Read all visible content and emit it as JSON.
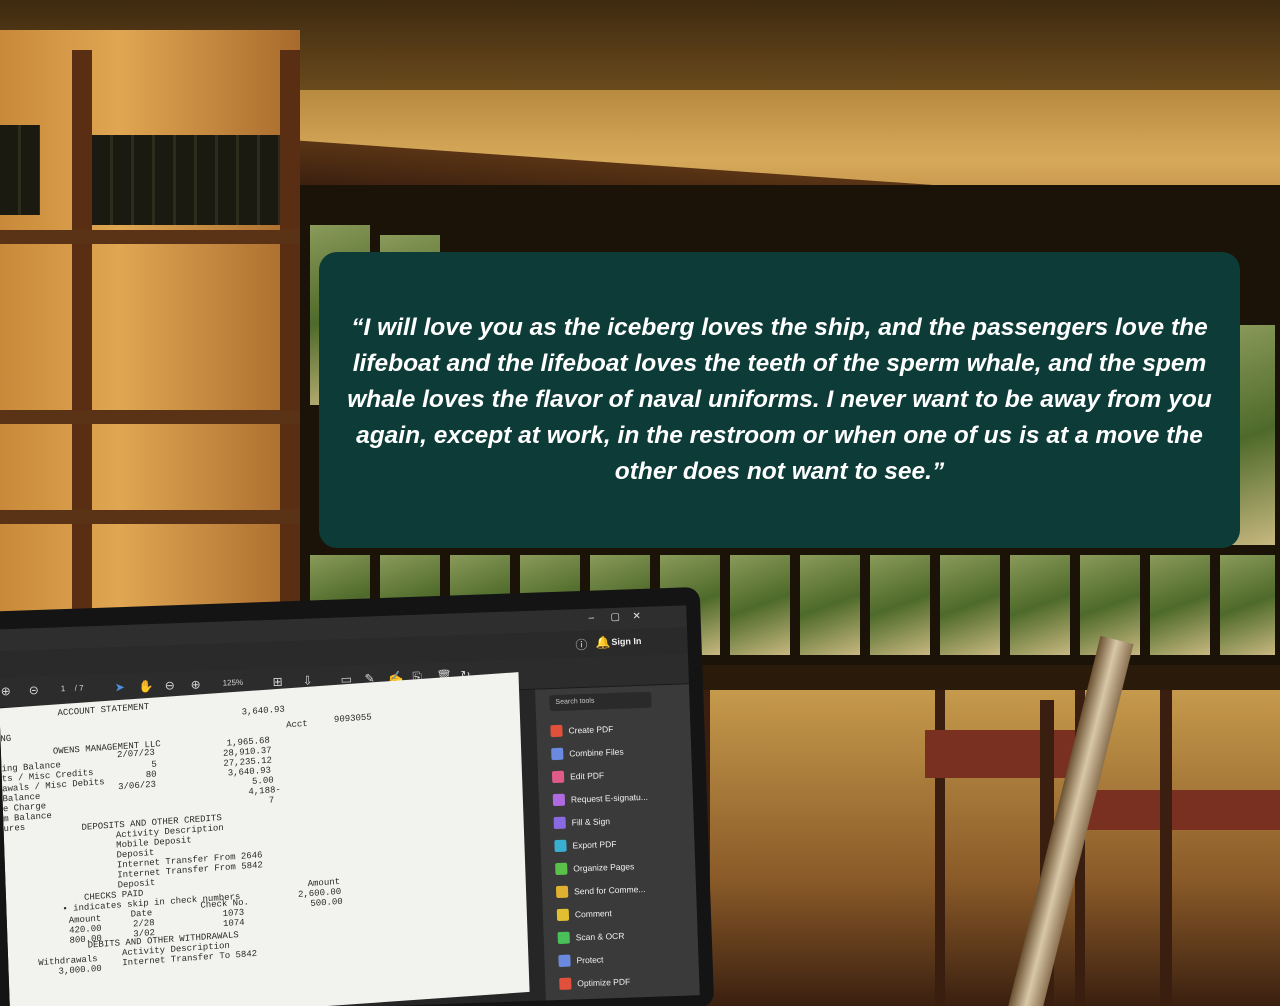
{
  "quote": {
    "text": "“I will love you as the iceberg loves the ship, and the passengers love the lifeboat and the lifeboat loves the teeth of the sperm whale, and the spem whale loves the flavor of naval uniforms. I never want to be away from you again, except at work, in the restroom or when one of us is at a move the other does not want to see.”",
    "background_color": "#0d3b37",
    "text_color": "#ffffff"
  },
  "laptop": {
    "window_controls": [
      "–",
      "▢",
      "✕"
    ],
    "account": {
      "signin_label": "Sign In"
    },
    "toolbar": {
      "page_current": "1",
      "page_total": "/ 7",
      "zoom": "125%"
    },
    "document": {
      "lines": [
        "ACCOUNT STATEMENT",
        "3,640.93",
        "NG",
        "Acct",
        "9093055",
        "OWENS MANAGEMENT LLC",
        "ing Balance",
        "2/07/23",
        "1,965.68",
        "28,910.37",
        "ts / Misc Credits",
        "5",
        "27,235.12",
        "awals / Misc Debits",
        "80",
        "3,640.93",
        "Balance",
        "3/06/23",
        "5.00",
        "e Charge",
        "4,188-",
        "m Balance",
        "7",
        "ures",
        "DEPOSITS AND OTHER CREDITS",
        "Activity Description",
        "Mobile Deposit",
        "Deposit",
        "Internet Transfer From 2646",
        "Internet Transfer From 5842",
        "Deposit",
        "CHECKS PAID",
        "Amount",
        "• indicates skip in check numbers",
        "2,600.00",
        "Amount",
        "Date",
        "Check No.",
        "500.00",
        "420.00",
        "2/28",
        "1073",
        "800.00",
        "3/02",
        "1074",
        "DEBITS AND OTHER WITHDRAWALS",
        "Withdrawals",
        "Activity Description",
        "3,000.00",
        "Internet Transfer To 5842"
      ]
    },
    "tools_panel": {
      "search_placeholder": "Search tools",
      "tools": [
        {
          "label": "Create PDF",
          "icon": "create-pdf-icon",
          "color": "#e0503a"
        },
        {
          "label": "Combine Files",
          "icon": "combine-files-icon",
          "color": "#6a8ae0"
        },
        {
          "label": "Edit PDF",
          "icon": "edit-pdf-icon",
          "color": "#e05a8a"
        },
        {
          "label": "Request E-signatu...",
          "icon": "request-esign-icon",
          "color": "#b06ae0"
        },
        {
          "label": "Fill & Sign",
          "icon": "fill-sign-icon",
          "color": "#8a6ae0"
        },
        {
          "label": "Export PDF",
          "icon": "export-pdf-icon",
          "color": "#3ab0d0"
        },
        {
          "label": "Organize Pages",
          "icon": "organize-pages-icon",
          "color": "#5ac04a"
        },
        {
          "label": "Send for Comme...",
          "icon": "send-comment-icon",
          "color": "#e0b030"
        },
        {
          "label": "Comment",
          "icon": "comment-icon",
          "color": "#e0c030"
        },
        {
          "label": "Scan & OCR",
          "icon": "scan-ocr-icon",
          "color": "#4ac05a"
        },
        {
          "label": "Protect",
          "icon": "protect-icon",
          "color": "#6a8ae0"
        },
        {
          "label": "Optimize PDF",
          "icon": "optimize-pdf-icon",
          "color": "#e0503a"
        }
      ]
    }
  }
}
